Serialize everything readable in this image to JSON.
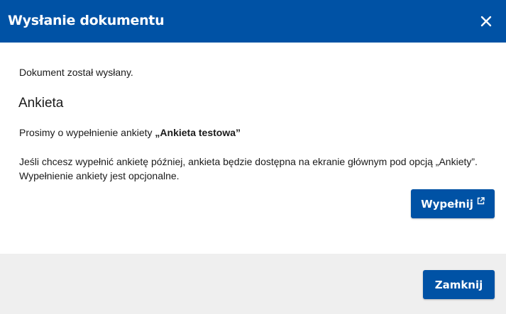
{
  "dialog": {
    "title": "Wysłanie dokumentu",
    "close_icon": "close-icon",
    "colors": {
      "header_bg": "#0052a5",
      "button_bg": "#0052a5",
      "footer_bg": "#efefef"
    }
  },
  "content": {
    "sent_message": "Dokument został wysłany.",
    "section_title": "Ankieta",
    "request_prefix": "Prosimy o wypełnienie ankiety ",
    "survey_name": "„Ankieta testowa”",
    "info_line_1": "Jeśli chcesz wypełnić ankietę później, ankieta będzie dostępna na ekranie głównym pod opcją „Ankiety”.",
    "info_line_2": "Wypełnienie ankiety jest opcjonalne."
  },
  "actions": {
    "fill_label": "Wypełnij",
    "fill_icon": "external-link-icon",
    "close_label": "Zamknij"
  }
}
